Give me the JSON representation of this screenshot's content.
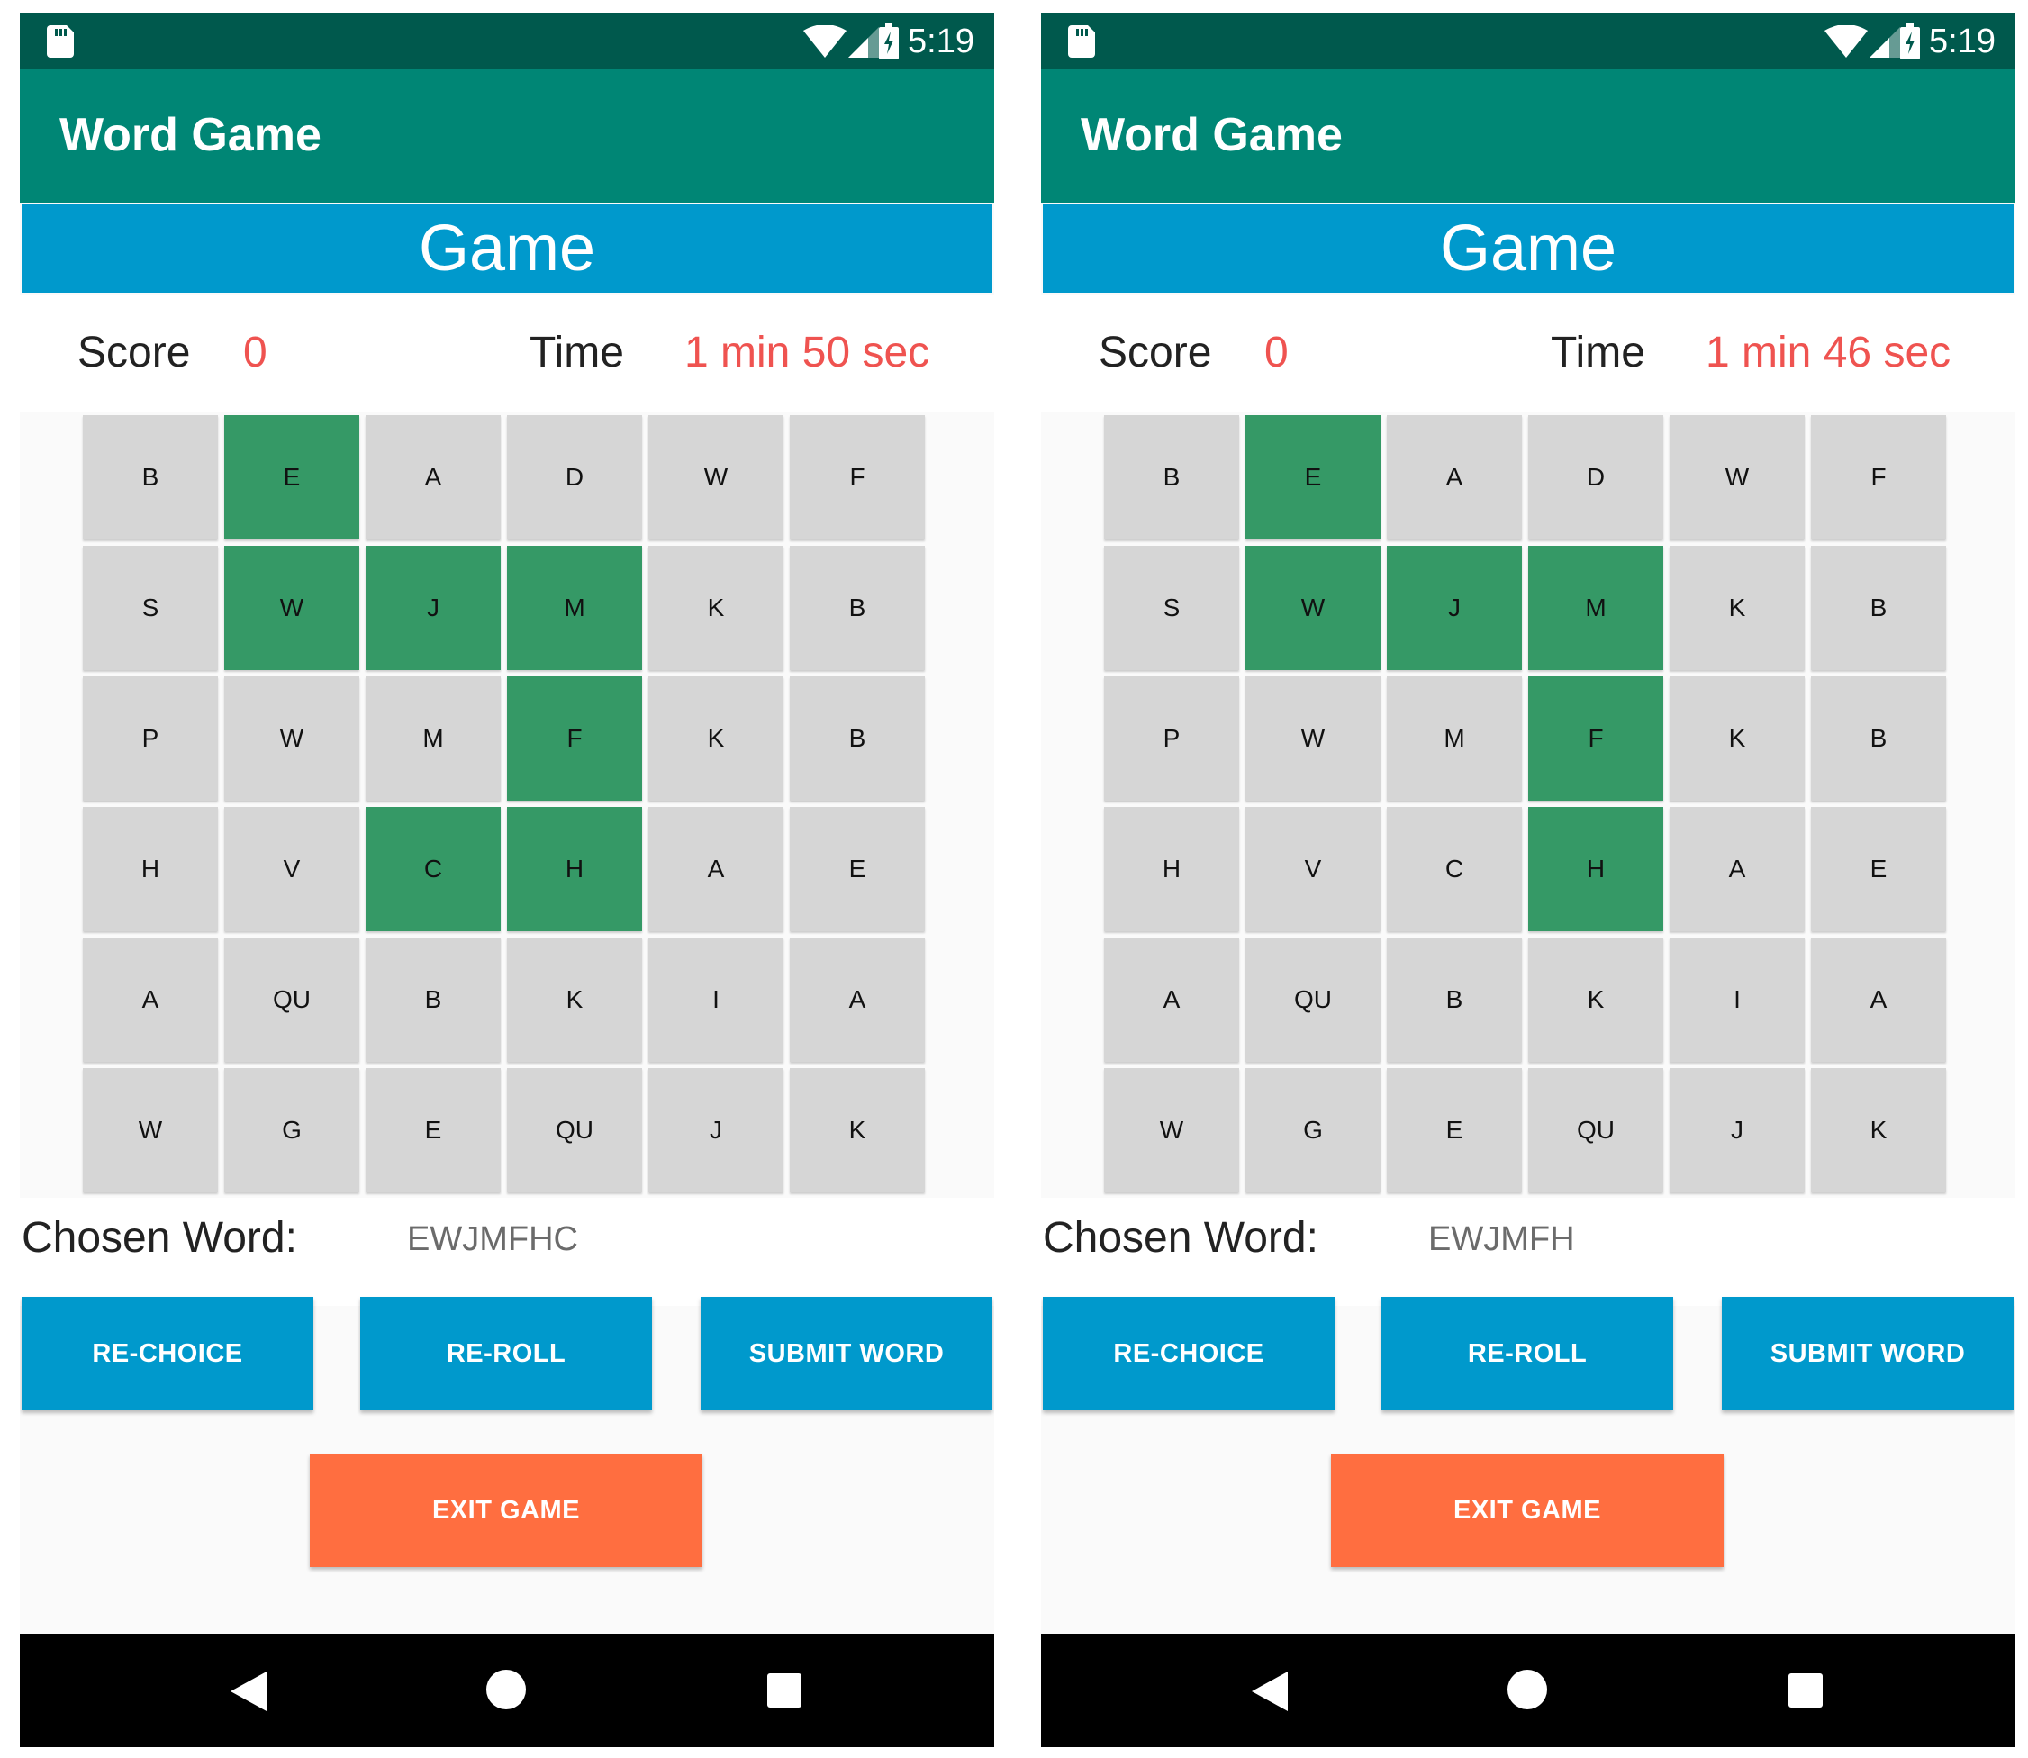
{
  "screens": [
    {
      "status_bar": {
        "time": "5:19"
      },
      "app_bar": {
        "title": "Word Game"
      },
      "header": {
        "title": "Game"
      },
      "score": {
        "label": "Score",
        "value": "0"
      },
      "time": {
        "label": "Time",
        "value": "1 min 50 sec"
      },
      "grid": [
        [
          "B",
          "E",
          "A",
          "D",
          "W",
          "F"
        ],
        [
          "S",
          "W",
          "J",
          "M",
          "K",
          "B"
        ],
        [
          "P",
          "W",
          "M",
          "F",
          "K",
          "B"
        ],
        [
          "H",
          "V",
          "C",
          "H",
          "A",
          "E"
        ],
        [
          "A",
          "QU",
          "B",
          "K",
          "I",
          "A"
        ],
        [
          "W",
          "G",
          "E",
          "QU",
          "J",
          "K"
        ]
      ],
      "selected_cells": [
        [
          0,
          1
        ],
        [
          1,
          1
        ],
        [
          1,
          2
        ],
        [
          1,
          3
        ],
        [
          2,
          3
        ],
        [
          3,
          2
        ],
        [
          3,
          3
        ]
      ],
      "chosen_word": {
        "label": "Chosen Word:",
        "value": "EWJMFHC"
      },
      "buttons": {
        "re_choice": "RE-CHOICE",
        "re_roll": "RE-ROLL",
        "submit": "SUBMIT WORD",
        "exit": "EXIT GAME"
      }
    },
    {
      "status_bar": {
        "time": "5:19"
      },
      "app_bar": {
        "title": "Word Game"
      },
      "header": {
        "title": "Game"
      },
      "score": {
        "label": "Score",
        "value": "0"
      },
      "time": {
        "label": "Time",
        "value": "1 min 46 sec"
      },
      "grid": [
        [
          "B",
          "E",
          "A",
          "D",
          "W",
          "F"
        ],
        [
          "S",
          "W",
          "J",
          "M",
          "K",
          "B"
        ],
        [
          "P",
          "W",
          "M",
          "F",
          "K",
          "B"
        ],
        [
          "H",
          "V",
          "C",
          "H",
          "A",
          "E"
        ],
        [
          "A",
          "QU",
          "B",
          "K",
          "I",
          "A"
        ],
        [
          "W",
          "G",
          "E",
          "QU",
          "J",
          "K"
        ]
      ],
      "selected_cells": [
        [
          0,
          1
        ],
        [
          1,
          1
        ],
        [
          1,
          2
        ],
        [
          1,
          3
        ],
        [
          2,
          3
        ],
        [
          3,
          3
        ]
      ],
      "chosen_word": {
        "label": "Chosen Word:",
        "value": "EWJMFH"
      },
      "buttons": {
        "re_choice": "RE-CHOICE",
        "re_roll": "RE-ROLL",
        "submit": "SUBMIT WORD",
        "exit": "EXIT GAME"
      }
    }
  ],
  "colors": {
    "status_bar": "#00594d",
    "app_bar": "#008675",
    "header": "#0099cc",
    "cell": "#d6d6d6",
    "cell_selected": "#359966",
    "accent_text": "#ef5350",
    "primary_button": "#0099cc",
    "exit_button": "#ff6e40"
  },
  "icons": {
    "status_bar": [
      "sd-card-icon",
      "wifi-icon",
      "signal-icon",
      "battery-charging-icon"
    ],
    "navigation": [
      "back-icon",
      "home-icon",
      "recent-apps-icon"
    ]
  }
}
